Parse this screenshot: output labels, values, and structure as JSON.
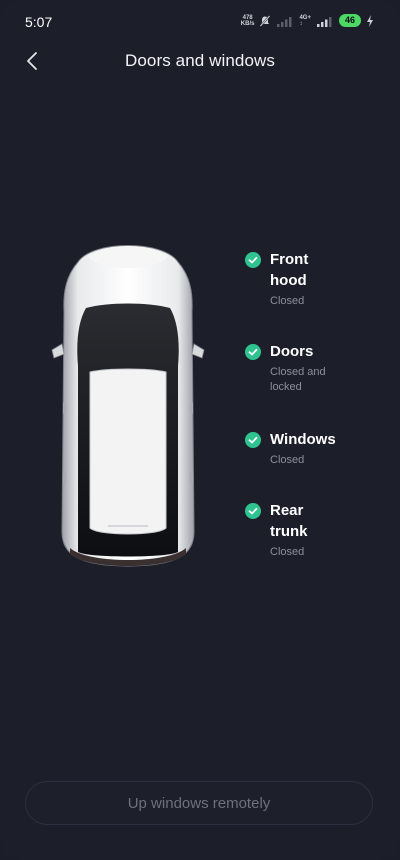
{
  "status_bar": {
    "time": "5:07",
    "net_speed_value": "478",
    "net_speed_unit": "KB/s",
    "net_type_top": "4G+",
    "net_type_bottom": "↕",
    "battery": "46",
    "battery_color": "#4cd964"
  },
  "header": {
    "back_icon": "chevron-left-icon",
    "title": "Doors and windows"
  },
  "vehicle_status": {
    "check_color": "#2ec38f",
    "items": [
      {
        "title_line1": "Front",
        "title_line2": "hood",
        "status": "Closed"
      },
      {
        "title_line1": "Doors",
        "status_line1": "Closed and",
        "status_line2": "locked"
      },
      {
        "title_line1": "Windows",
        "status": "Closed"
      },
      {
        "title_line1": "Rear",
        "title_line2": "trunk",
        "status": "Closed"
      }
    ]
  },
  "actions": {
    "up_windows_label": "Up windows remotely"
  }
}
